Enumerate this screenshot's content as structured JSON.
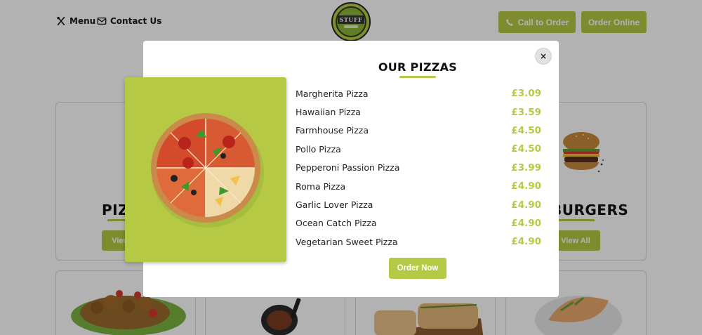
{
  "nav": {
    "menu_label": "Menu",
    "contact_label": "Contact Us",
    "logo_text": "STUFF",
    "call_label": "Call to Order",
    "order_online_label": "Order Online"
  },
  "cards": {
    "pizza": {
      "title": "PIZZAS",
      "button": "View All"
    },
    "burgers": {
      "title": "BURGERS",
      "button": "View All"
    }
  },
  "modal": {
    "title": "OUR PIZZAS",
    "close_glyph": "×",
    "items": [
      {
        "name": "Margherita Pizza",
        "price": "£3.09"
      },
      {
        "name": "Hawaiian Pizza",
        "price": "£3.59"
      },
      {
        "name": "Farmhouse Pizza",
        "price": "£4.50"
      },
      {
        "name": "Pollo Pizza",
        "price": "£4.50"
      },
      {
        "name": "Pepperoni Passion Pizza",
        "price": "£3.99"
      },
      {
        "name": "Roma Pizza",
        "price": "£4.90"
      },
      {
        "name": "Garlic Lover Pizza",
        "price": "£4.90"
      },
      {
        "name": "Ocean Catch Pizza",
        "price": "£4.90"
      },
      {
        "name": "Vegetarian Sweet Pizza",
        "price": "£4.90"
      }
    ],
    "order_now_label": "Order Now"
  },
  "icons": {
    "menu": "utensils-icon",
    "contact": "mail-icon",
    "call": "phone-icon",
    "close": "close-icon"
  },
  "colors": {
    "accent": "#b5c944",
    "text": "#222222",
    "overlay": "rgba(0,0,0,0.30)"
  }
}
